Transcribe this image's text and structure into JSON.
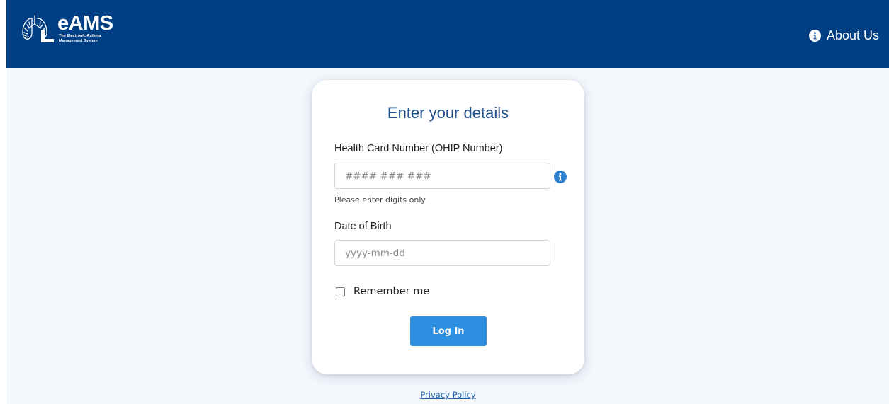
{
  "header": {
    "logo": {
      "name": "eAMS",
      "tagline": "The Electronic Asthma Management System",
      "icon": "lungs-logo-icon"
    },
    "about": {
      "label": "About Us",
      "icon": "info-circle-icon"
    }
  },
  "login_card": {
    "title": "Enter your details",
    "health_card": {
      "label": "Health Card Number (OHIP Number)",
      "value": "",
      "placeholder": "#### ### ###",
      "hint": "Please enter digits only",
      "info_icon": "info-circle-icon"
    },
    "dob": {
      "label": "Date of Birth",
      "value": "",
      "placeholder": "yyyy-mm-dd"
    },
    "remember": {
      "label": "Remember me",
      "checked": false
    },
    "submit_label": "Log In"
  },
  "footer": {
    "privacy_label": "Privacy Policy"
  },
  "colors": {
    "header_bg": "#003f84",
    "page_bg": "#f3f8fd",
    "accent": "#2d8fe0",
    "title": "#1e4f8d"
  }
}
